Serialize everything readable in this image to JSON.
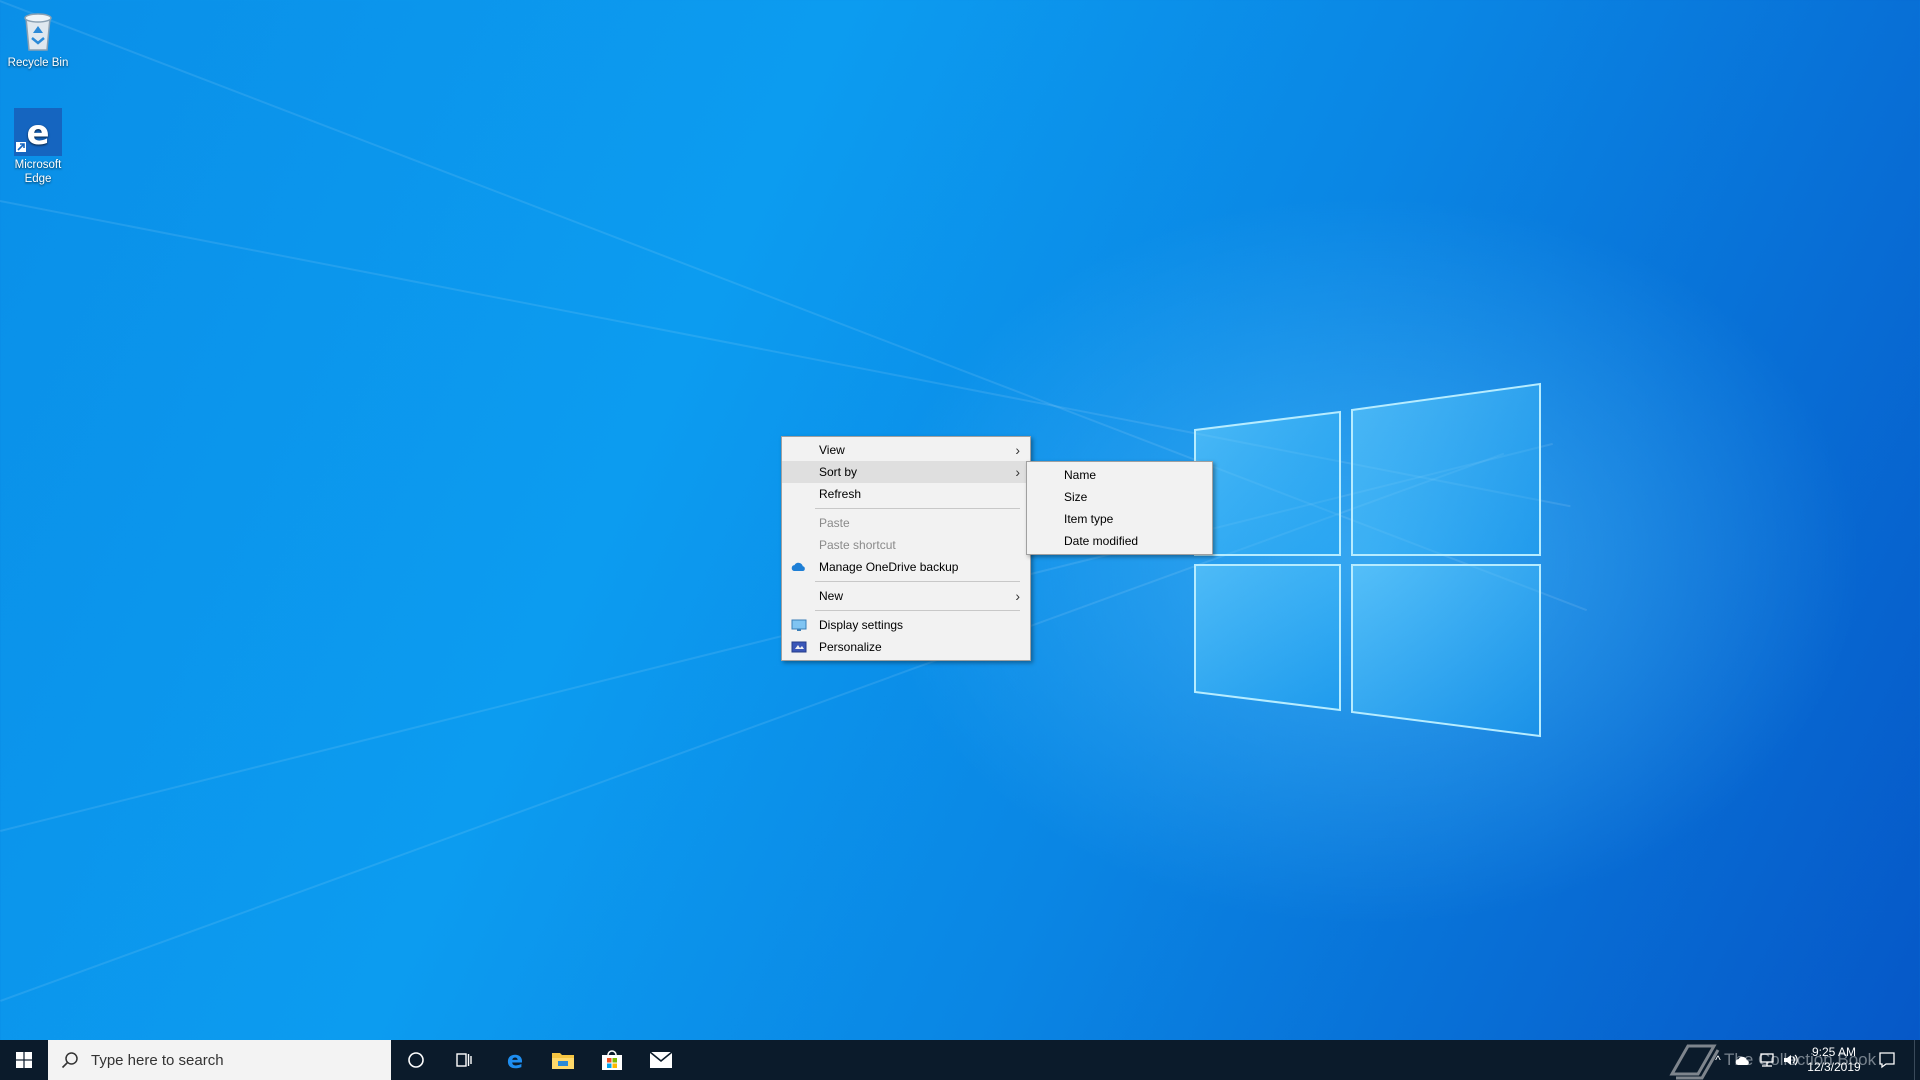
{
  "desktop": {
    "icons": [
      {
        "label": "Recycle Bin",
        "icon": "recycle-bin-icon"
      },
      {
        "label": "Microsoft Edge",
        "icon": "edge-icon"
      }
    ]
  },
  "context_menu": {
    "items": [
      {
        "label": "View",
        "submenu": true
      },
      {
        "label": "Sort by",
        "submenu": true,
        "highlighted": true
      },
      {
        "label": "Refresh"
      },
      {
        "label": "Paste",
        "disabled": true
      },
      {
        "label": "Paste shortcut",
        "disabled": true
      },
      {
        "label": "Manage OneDrive backup",
        "icon": "onedrive-icon"
      },
      {
        "label": "New",
        "submenu": true
      },
      {
        "label": "Display settings",
        "icon": "display-icon"
      },
      {
        "label": "Personalize",
        "icon": "personalize-icon"
      }
    ]
  },
  "sort_submenu": {
    "items": [
      {
        "label": "Name"
      },
      {
        "label": "Size"
      },
      {
        "label": "Item type"
      },
      {
        "label": "Date modified"
      }
    ]
  },
  "taskbar": {
    "search_placeholder": "Type here to search",
    "pinned": [
      "cortana-icon",
      "task-view-icon",
      "edge-icon",
      "file-explorer-icon",
      "store-icon",
      "mail-icon"
    ],
    "clock_time": "9:25 AM",
    "clock_date": "12/3/2019",
    "watermark": "The Collection Book"
  },
  "colors": {
    "wallpaper_accent": "#0a8fe8",
    "taskbar": "#0b1b2b",
    "menu_bg": "#f2f2f2",
    "menu_highlight": "#dfdfdf"
  }
}
